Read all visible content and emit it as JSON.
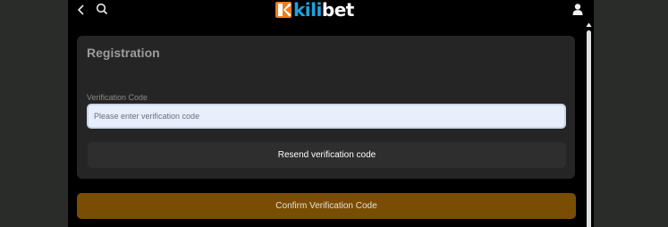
{
  "header": {
    "back_icon": "chevron-left-icon",
    "search_icon": "search-icon",
    "account_icon": "user-icon",
    "logo": {
      "part1": "kili",
      "part2": "bet",
      "brand_color": "#1fa3dc"
    }
  },
  "registration": {
    "title": "Registration",
    "verification_label": "Verification Code",
    "verification_placeholder": "Please enter verification code",
    "verification_value": "",
    "resend_label": "Resend verification code"
  },
  "actions": {
    "confirm_label": "Confirm Verification Code",
    "confirm_color": "#7a4d05"
  }
}
